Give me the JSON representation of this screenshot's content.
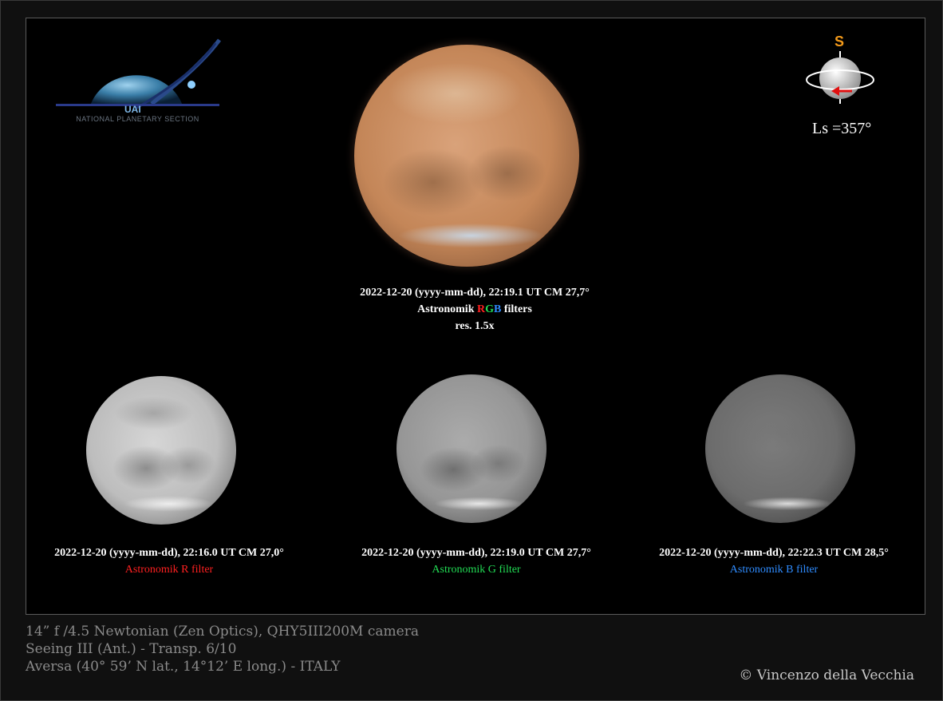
{
  "logo": {
    "org": "UAI",
    "section": "NATIONAL PLANETARY SECTION"
  },
  "orientation": {
    "south_label": "S",
    "ls": "Ls =357°"
  },
  "main": {
    "line1": "2022-12-20 (yyyy-mm-dd), 22:19.1 UT  CM  27,7°",
    "filter_prefix": "Astronomik ",
    "filter_r": "R",
    "filter_g": "G",
    "filter_b": "B",
    "filter_suffix": " filters",
    "res": "res. 1.5x"
  },
  "panels": [
    {
      "line1": "2022-12-20 (yyyy-mm-dd), 22:16.0 UT  CM  27,0°",
      "filter": "Astronomik R filter",
      "color": "#ff2020"
    },
    {
      "line1": "2022-12-20 (yyyy-mm-dd), 22:19.0 UT  CM  27,7°",
      "filter": "Astronomik G filter",
      "color": "#22dd55"
    },
    {
      "line1": "2022-12-20 (yyyy-mm-dd), 22:22.3 UT  CM  28,5°",
      "filter": "Astronomik B filter",
      "color": "#2f8cff"
    }
  ],
  "footer": {
    "line1": "14” f /4.5 Newtonian (Zen Optics), QHY5III200M camera",
    "line2": "Seeing  III (Ant.) - Transp. 6/10",
    "line3": "Aversa (40° 59’ N lat., 14°12’ E long.) - ITALY"
  },
  "copyright": "© Vincenzo della Vecchia"
}
